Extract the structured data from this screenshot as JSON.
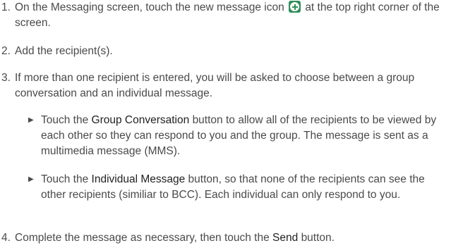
{
  "steps": [
    {
      "num": "1.",
      "text_before": "On the Messaging screen, touch the new message icon",
      "text_after": "at the top right corner of the screen."
    },
    {
      "num": "2.",
      "text": "Add the recipient(s)."
    },
    {
      "num": "3.",
      "text": "If more than one recipient is entered, you will be asked to choose between a group conversation and an individual message."
    },
    {
      "num": "4.",
      "text_before": "Complete the message as necessary, then touch the",
      "bold": "Send",
      "text_after": "button."
    }
  ],
  "bullets": [
    {
      "prefix": "Touch the",
      "bold": "Group Conversation",
      "suffix": "button to allow all of the recipients to be viewed by each other so they can respond to you and the group. The message is sent as a multimedia message (MMS)."
    },
    {
      "prefix": "Touch the",
      "bold": "Individual Message",
      "suffix": "button, so that none of the recipients can see the other recipients (similiar to BCC). Each individual can only respond to you."
    }
  ],
  "icons": {
    "new_message": "new-message-plus-icon",
    "bullet_marker": "triangle-bullet"
  },
  "colors": {
    "text": "#4a4a4a",
    "icon_bg": "#2f8f5a"
  }
}
